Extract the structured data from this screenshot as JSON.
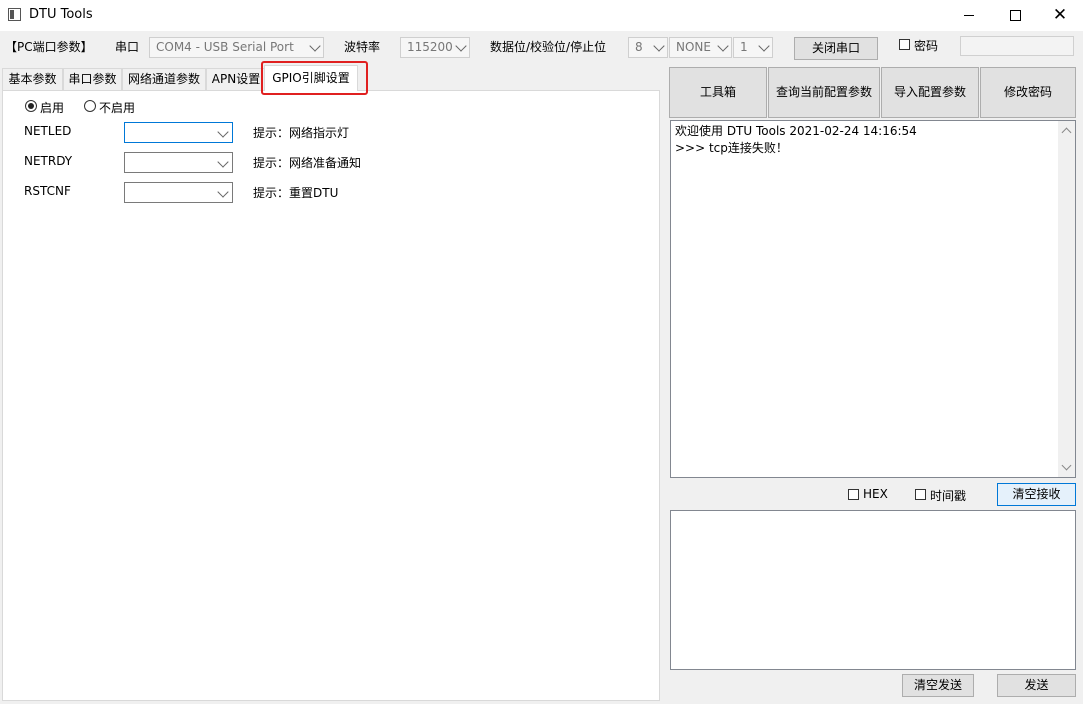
{
  "window": {
    "title": "DTU Tools",
    "minimize": "—",
    "maximize": "☐",
    "close": "✕"
  },
  "config_row": {
    "group_label": "【PC端口参数】",
    "port_label": "串口",
    "port_value": "COM4 - USB Serial Port",
    "baud_label": "波特率",
    "baud_value": "115200",
    "frame_label": "数据位/校验位/停止位",
    "databits_value": "8",
    "parity_value": "NONE",
    "stopbits_value": "1",
    "close_port_button": "关闭串口",
    "password_checkbox": "密码",
    "password_value": ""
  },
  "tabs": [
    {
      "label": "基本参数",
      "active": false
    },
    {
      "label": "串口参数",
      "active": false
    },
    {
      "label": "网络通道参数",
      "active": false
    },
    {
      "label": "APN设置",
      "active": false
    },
    {
      "label": "GPIO引脚设置",
      "active": true
    }
  ],
  "gpio": {
    "enable_label": "启用",
    "disable_label": "不启用",
    "enabled": true,
    "rows": [
      {
        "name": "NETLED",
        "value": "",
        "hint": "提示：网络指示灯"
      },
      {
        "name": "NETRDY",
        "value": "",
        "hint": "提示：网络准备通知"
      },
      {
        "name": "RSTCNF",
        "value": "",
        "hint": "提示：重置DTU"
      }
    ]
  },
  "toolbar": {
    "toolbox": "工具箱",
    "query_config": "查询当前配置参数",
    "import_config": "导入配置参数",
    "change_password": "修改密码"
  },
  "log": {
    "line1": "欢迎使用 DTU Tools 2021-02-24 14:16:54",
    "line2": ">>> tcp连接失败！"
  },
  "receive_options": {
    "hex": "HEX",
    "timestamp": "时间戳",
    "clear_receive": "清空接收"
  },
  "send": {
    "value": "",
    "clear_send": "清空发送",
    "send_button": "发送"
  }
}
